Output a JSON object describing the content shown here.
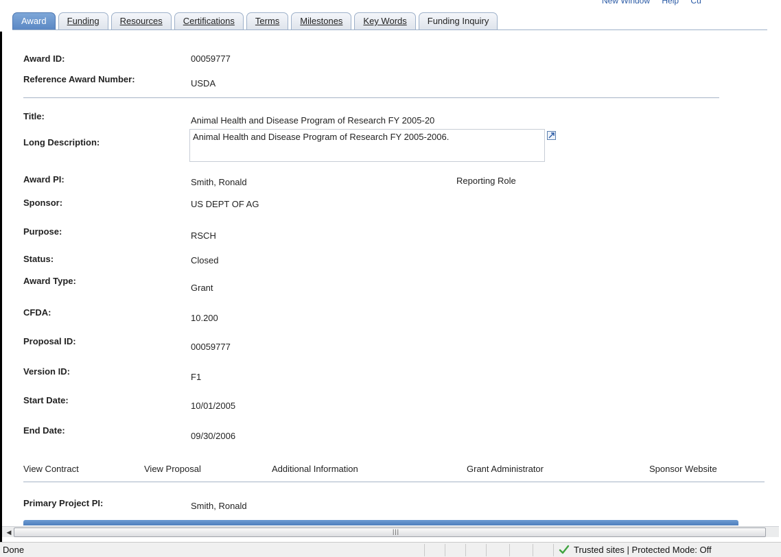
{
  "toolbar": {
    "new_window": "New Window",
    "help": "Help",
    "customize": "Cu"
  },
  "tabs": [
    {
      "label": "Award",
      "active": true
    },
    {
      "label": "Funding",
      "active": false
    },
    {
      "label": "Resources",
      "active": false
    },
    {
      "label": "Certifications",
      "active": false
    },
    {
      "label": "Terms",
      "active": false
    },
    {
      "label": "Milestones",
      "active": false
    },
    {
      "label": "Key Words",
      "active": false
    },
    {
      "label": "Funding Inquiry",
      "active": false
    }
  ],
  "award": {
    "award_id_label": "Award ID:",
    "award_id": "00059777",
    "reference_label": "Reference Award Number:",
    "reference": "USDA",
    "title_label": "Title:",
    "title": "Animal Health and Disease Program of Research FY 2005-20",
    "long_desc_label": "Long Description:",
    "long_desc": "Animal Health and Disease Program of Research FY 2005-2006.",
    "pi_label": "Award PI:",
    "pi": "Smith, Ronald",
    "reporting_role": "Reporting Role",
    "sponsor_label": "Sponsor:",
    "sponsor": "US DEPT OF AG",
    "purpose_label": "Purpose:",
    "purpose": "RSCH",
    "status_label": "Status:",
    "status": "Closed",
    "type_label": "Award Type:",
    "type": "Grant",
    "cfda_label": "CFDA:",
    "cfda": "10.200",
    "proposal_label": "Proposal ID:",
    "proposal": "00059777",
    "version_label": "Version ID:",
    "version": "F1",
    "start_label": "Start Date:",
    "start": "10/01/2005",
    "end_label": "End Date:",
    "end": "09/30/2006",
    "primary_pi_label": "Primary Project PI:",
    "primary_pi": "Smith, Ronald"
  },
  "links": {
    "view_contract": "View Contract",
    "view_proposal": "View Proposal",
    "additional_info": "Additional Information",
    "grant_admin": "Grant Administrator",
    "sponsor_website": "Sponsor Website"
  },
  "status": {
    "text": "Done",
    "zone": "Trusted sites | Protected Mode: Off"
  },
  "colors": {
    "active_tab": "#5b88c4",
    "divider": "#a6b4c6",
    "check": "#3fa33f"
  }
}
